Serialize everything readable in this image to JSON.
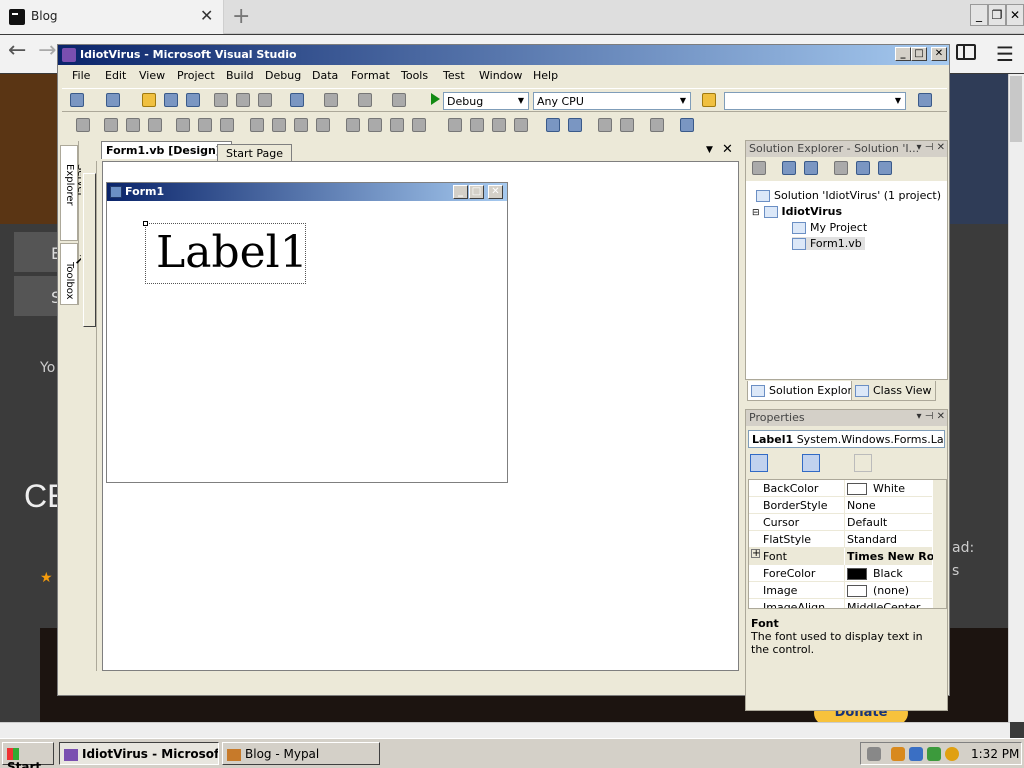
{
  "browser": {
    "tab_title": "Blog",
    "tab_close": "✕",
    "new_tab": "+",
    "minimize": "_",
    "restore": "❐",
    "close": "✕",
    "back": "←",
    "forward": "→",
    "menu": "☰"
  },
  "web_page": {
    "btn1": "E",
    "btn2": "S",
    "text_you": "Yo",
    "heading": "CE",
    "right_text1": "ad:",
    "right_text2": "s",
    "donate": "Donate"
  },
  "vs": {
    "title": "IdiotVirus - Microsoft Visual Studio",
    "title_min": "_",
    "title_max": "□",
    "title_close": "✕",
    "menu": [
      "File",
      "Edit",
      "View",
      "Project",
      "Build",
      "Debug",
      "Data",
      "Format",
      "Tools",
      "Test",
      "Window",
      "Help"
    ],
    "config_combo": "Debug",
    "platform_combo": "Any CPU",
    "find_combo": ""
  },
  "side_tabs": {
    "server_explorer": "Server Explorer",
    "toolbox": "Toolbox"
  },
  "documents": {
    "active_tab": "Form1.vb [Design]*",
    "other_tab": "Start Page",
    "dropdown": "▼",
    "close": "✕"
  },
  "form": {
    "title": "Form1",
    "min": "_",
    "max": "□",
    "close": "✕",
    "label_text": "Label1"
  },
  "solution_explorer": {
    "title": "Solution Explorer - Solution 'I...",
    "pin_buttons": "▾ ⊣ ✕",
    "solution_node": "Solution 'IdiotVirus' (1 project)",
    "project_node": "IdiotVirus",
    "my_project": "My Project",
    "form_file": "Form1.vb",
    "tab_solution": "Solution Explorer",
    "tab_class": "Class View"
  },
  "properties": {
    "title": "Properties",
    "pin_buttons": "▾ ⊣ ✕",
    "object_name": "Label1",
    "object_type": "System.Windows.Forms.Labe",
    "rows": [
      {
        "name": "BackColor",
        "value": "White",
        "swatch": "#ffffff"
      },
      {
        "name": "BorderStyle",
        "value": "None"
      },
      {
        "name": "Cursor",
        "value": "Default"
      },
      {
        "name": "FlatStyle",
        "value": "Standard"
      },
      {
        "name": "Font",
        "value": "Times New Ron",
        "expand": "+"
      },
      {
        "name": "ForeColor",
        "value": "Black",
        "swatch": "#000000"
      },
      {
        "name": "Image",
        "value": "(none)",
        "swatch": "#ffffff"
      },
      {
        "name": "ImageAlign",
        "value": "MiddleCenter"
      }
    ],
    "desc_title": "Font",
    "desc_text": "The font used to display text in the control."
  },
  "taskbar": {
    "start": "Start",
    "task_vs": "IdiotVirus - Microsoft ...",
    "task_blog": "Blog - Mypal",
    "clock": "1:32 PM"
  },
  "colors": {
    "title_gradient_start": "#0a246a",
    "title_gradient_end": "#a6caf0",
    "donate": "#f7c23c"
  }
}
